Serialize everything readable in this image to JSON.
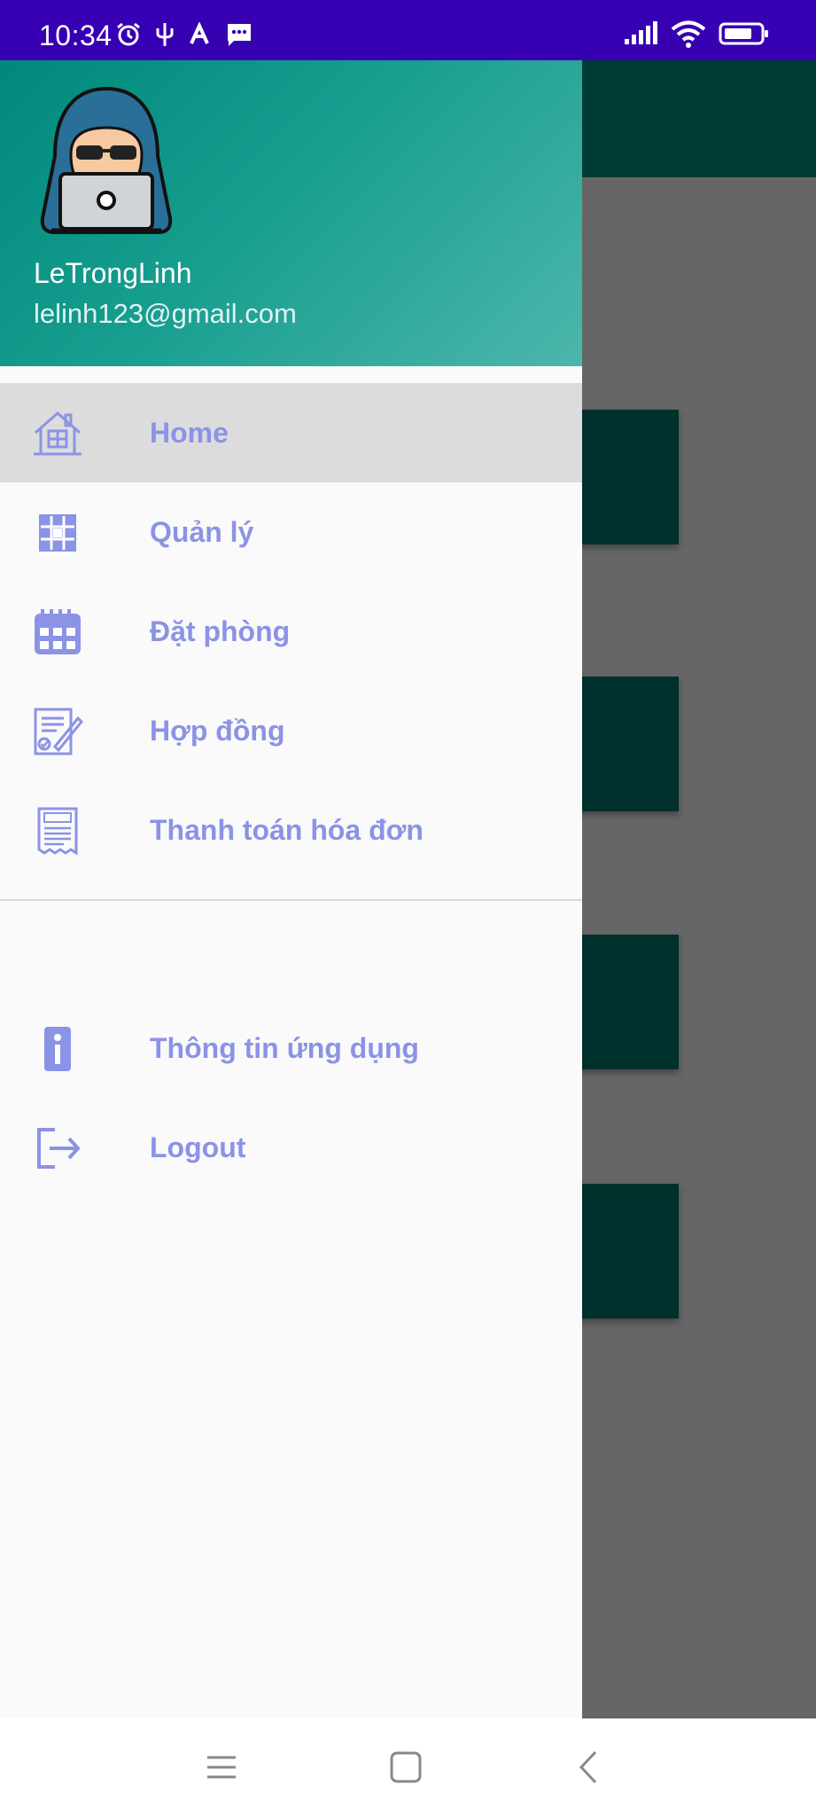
{
  "status_bar": {
    "time": "10:34",
    "left_icons": [
      "alarm-icon",
      "usb-icon",
      "font-app-icon",
      "message-icon"
    ],
    "right_icons": [
      "signal-icon",
      "wifi-icon",
      "battery-icon"
    ],
    "background_color": "#3700b3"
  },
  "drawer": {
    "header": {
      "user_name": "LeTrongLinh",
      "user_email": "lelinh123@gmail.com",
      "avatar_icon": "hacker-avatar-icon"
    },
    "menu_items": [
      {
        "label": "Home",
        "icon": "house-icon",
        "active": true
      },
      {
        "label": "Quản lý",
        "icon": "manage-grid-icon",
        "active": false
      },
      {
        "label": "Đặt phòng",
        "icon": "calendar-icon",
        "active": false
      },
      {
        "label": "Hợp đồng",
        "icon": "contract-icon",
        "active": false
      },
      {
        "label": "Thanh toán hóa đơn",
        "icon": "bill-icon",
        "active": false
      }
    ],
    "secondary_items": [
      {
        "label": "Thông tin ứng dụng",
        "icon": "info-icon"
      },
      {
        "label": "Logout",
        "icon": "logout-icon"
      }
    ],
    "accent_color": "#8b93e6"
  },
  "nav_bar": {
    "buttons": [
      "menu-icon",
      "home-icon",
      "back-icon"
    ]
  }
}
